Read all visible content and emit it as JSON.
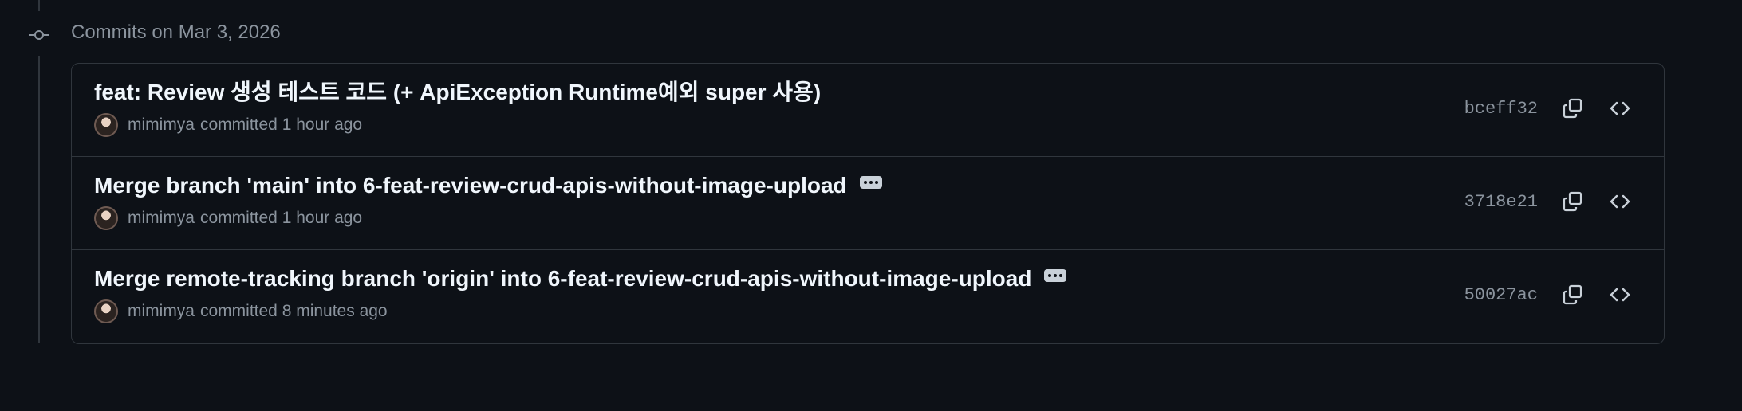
{
  "group": {
    "date_label": "Commits on Mar 3, 2026"
  },
  "commits": [
    {
      "title": "feat: Review 생성 테스트 코드 (+ ApiException Runtime예외 super 사용)",
      "author": "mimimya",
      "action_time": "committed 1 hour ago",
      "sha": "bceff32",
      "has_ellipsis": false
    },
    {
      "title": "Merge branch 'main' into 6-feat-review-crud-apis-without-image-upload",
      "author": "mimimya",
      "action_time": "committed 1 hour ago",
      "sha": "3718e21",
      "has_ellipsis": true
    },
    {
      "title": "Merge remote-tracking branch 'origin' into 6-feat-review-crud-apis-without-image-upload",
      "author": "mimimya",
      "action_time": "committed 8 minutes ago",
      "sha": "50027ac",
      "has_ellipsis": true
    }
  ],
  "icons": {
    "node": "git-commit-icon",
    "copy": "copy-icon",
    "browse": "code-icon",
    "more": "ellipsis-icon"
  },
  "colors": {
    "background": "#0d1117",
    "border": "#30363d",
    "text_primary": "#f0f6fc",
    "text_muted": "#8b949e"
  }
}
